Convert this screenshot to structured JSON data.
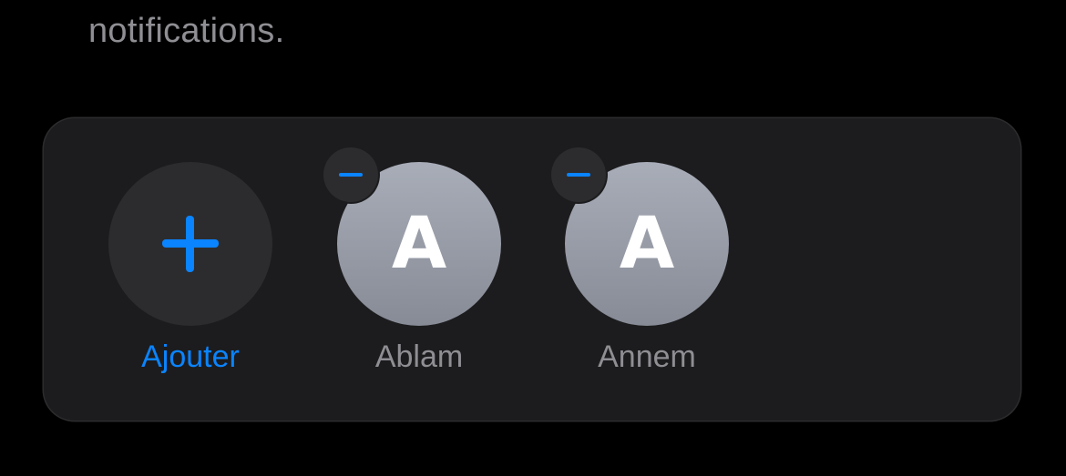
{
  "header": {
    "footer_text": "notifications."
  },
  "favorites": {
    "add": {
      "label": "Ajouter",
      "icon": "plus-icon"
    },
    "contacts": [
      {
        "initial": "A",
        "name": "Ablam",
        "remove_icon": "minus-icon"
      },
      {
        "initial": "A",
        "name": "Annem",
        "remove_icon": "minus-icon"
      }
    ]
  },
  "colors": {
    "accent": "#0a84ff",
    "background": "#000000",
    "card": "#1c1c1e",
    "secondary_text": "#8e8e93"
  }
}
